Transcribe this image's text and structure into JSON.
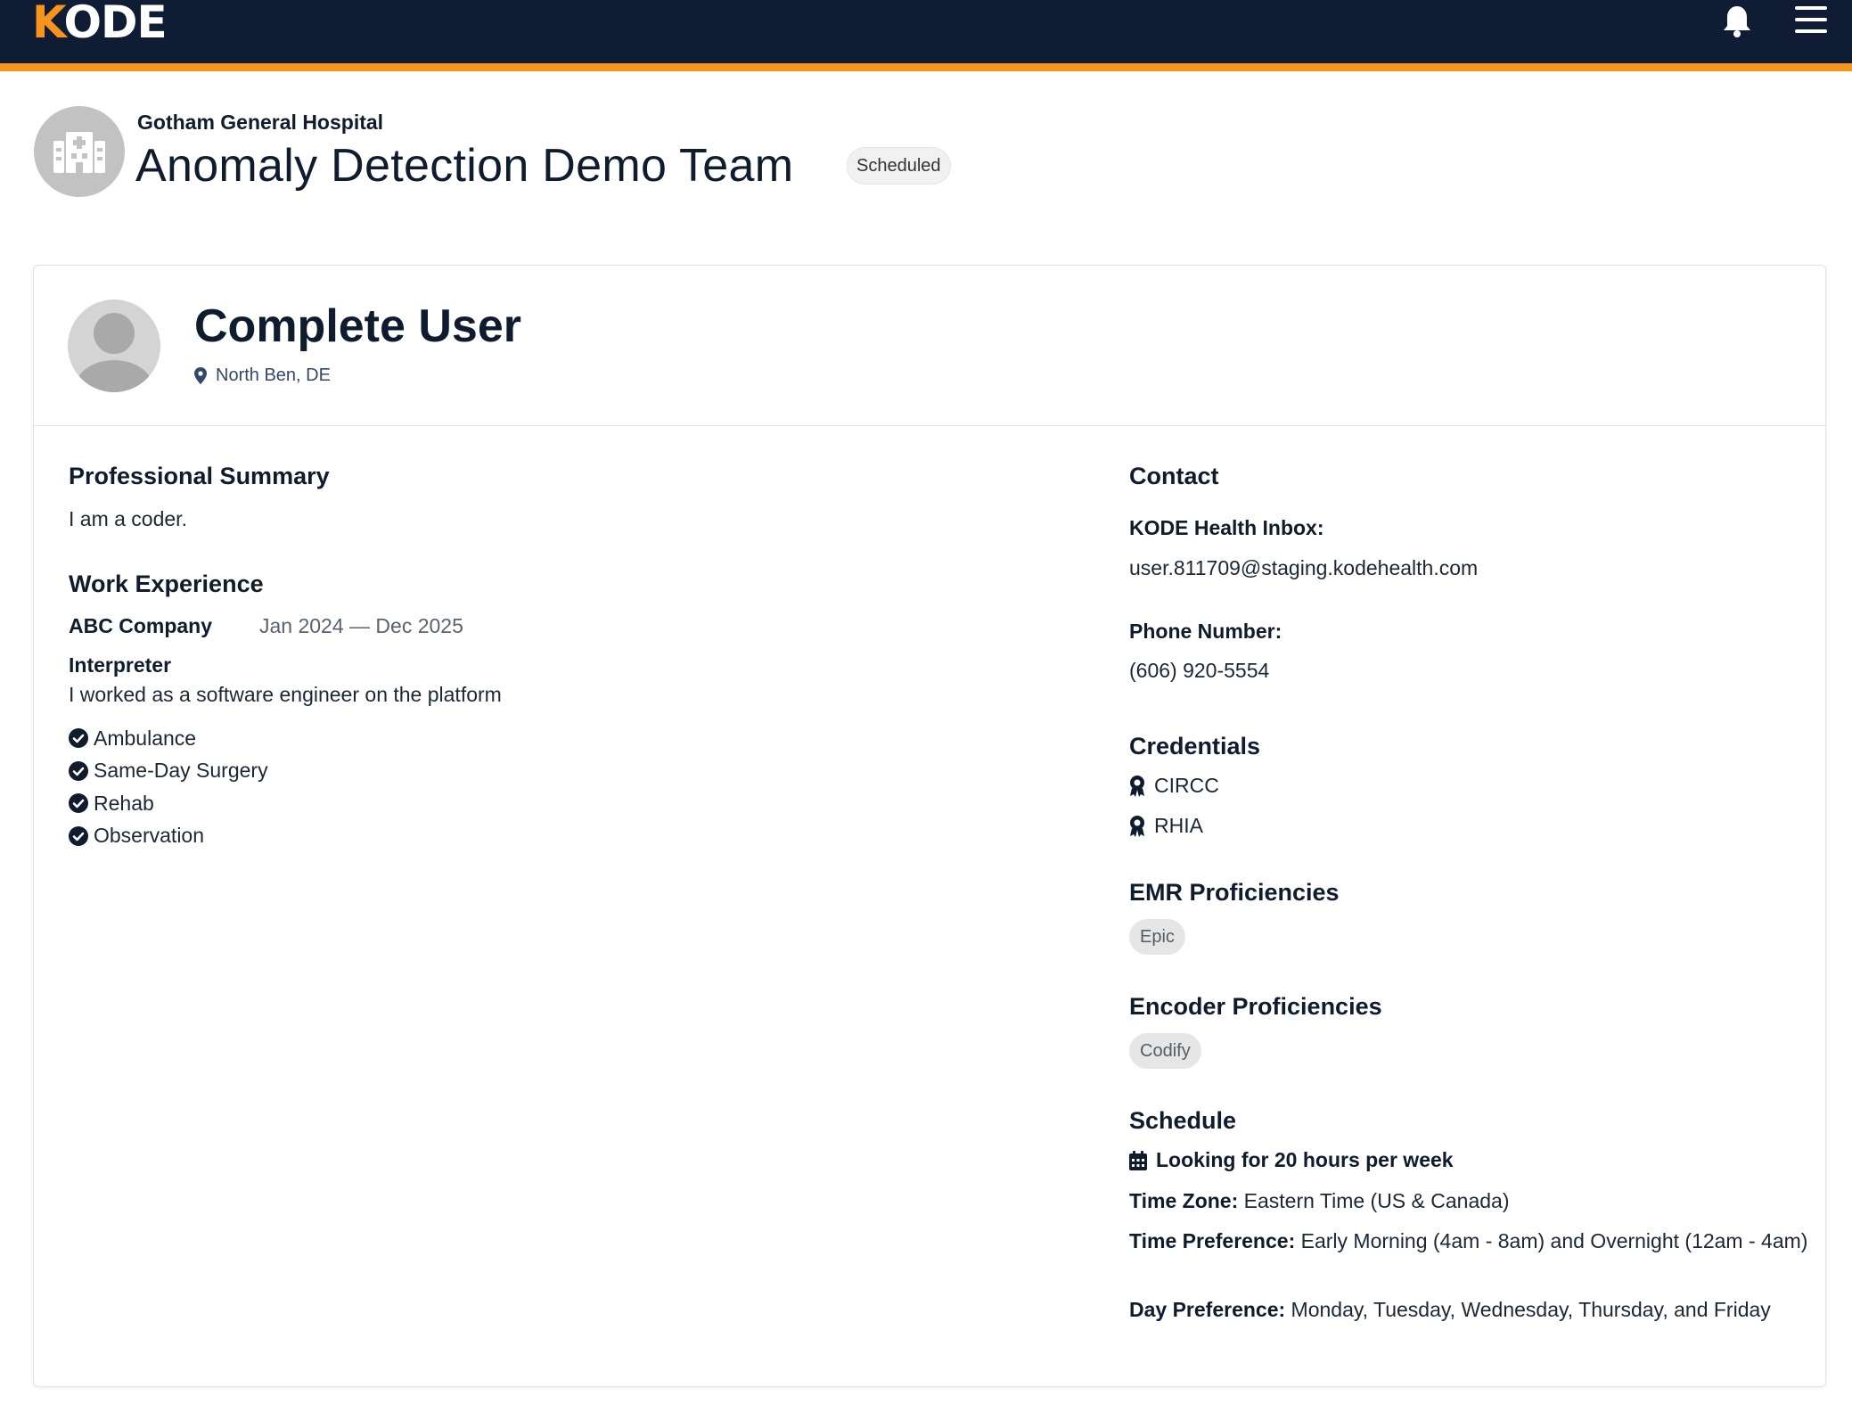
{
  "app": {
    "logo_first": "K",
    "logo_rest": "ODE",
    "brand_color": "#f7941d",
    "topbar_color": "#0f1c33",
    "icons": [
      "bell-icon",
      "hamburger-menu-icon"
    ]
  },
  "header": {
    "org_name": "Gotham General Hospital",
    "team_name": "Anomaly Detection Demo Team",
    "status": "Scheduled"
  },
  "profile": {
    "name": "Complete User",
    "location": "North Ben, DE"
  },
  "summary": {
    "title": "Professional Summary",
    "text": "I am a coder."
  },
  "work": {
    "title": "Work Experience",
    "company": "ABC Company",
    "dates": "Jan 2024 — Dec 2025",
    "role": "Interpreter",
    "description": "I worked as a software engineer on the platform",
    "settings": [
      "Ambulance",
      "Same-Day Surgery",
      "Rehab",
      "Observation"
    ]
  },
  "contact": {
    "title": "Contact",
    "inbox_label": "KODE Health Inbox:",
    "inbox_value": "user.811709@staging.kodehealth.com",
    "phone_label": "Phone Number:",
    "phone_value": "(606) 920-5554"
  },
  "credentials": {
    "title": "Credentials",
    "items": [
      "CIRCC",
      "RHIA"
    ]
  },
  "emr": {
    "title": "EMR Proficiencies",
    "items": [
      "Epic"
    ]
  },
  "encoder": {
    "title": "Encoder Proficiencies",
    "items": [
      "Codify"
    ]
  },
  "schedule": {
    "title": "Schedule",
    "hours": "Looking for 20 hours per week",
    "tz_label": "Time Zone:",
    "tz_value": "Eastern Time (US & Canada)",
    "time_pref_label": "Time Preference:",
    "time_pref_value": "Early Morning (4am - 8am) and Overnight (12am - 4am)",
    "day_pref_label": "Day Preference:",
    "day_pref_value": "Monday, Tuesday, Wednesday, Thursday, and Friday"
  }
}
